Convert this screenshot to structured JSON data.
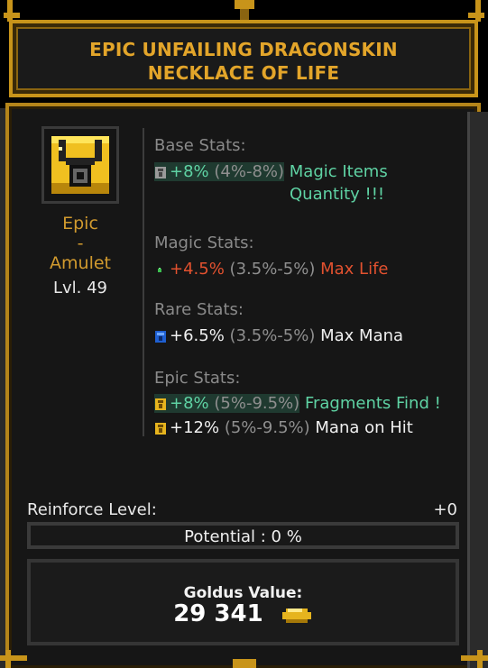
{
  "item": {
    "title_line1": "EPIC UNFAILING DRAGONSKIN",
    "title_line2": "NECKLACE OF LIFE",
    "rarity": "Epic",
    "dash": "-",
    "type": "Amulet",
    "level": "Lvl. 49",
    "icon": "golden-amulet-icon"
  },
  "sections": {
    "base": {
      "header": "Base Stats:",
      "stats": [
        {
          "value": "+8%",
          "range": "(4%-8%)",
          "name_line1": "Magic Items",
          "name_line2": "Quantity !!!",
          "gem": "gray-gem-icon",
          "value_color": "#5fd3a4",
          "name_color": "#5fd3a4"
        }
      ]
    },
    "magic": {
      "header": "Magic Stats:",
      "stats": [
        {
          "value": "+4.5%",
          "range": "(3.5%-5%)",
          "name": "Max Life",
          "gem": "green-gem-icon",
          "value_color": "#e2512f",
          "name_color": "#e2512f"
        }
      ]
    },
    "rare": {
      "header": "Rare Stats:",
      "stats": [
        {
          "value": "+6.5%",
          "range": "(3.5%-5%)",
          "name": "Max Mana",
          "gem": "blue-gem-icon",
          "value_color": "#f0f0f0",
          "name_color": "#f0f0f0"
        }
      ]
    },
    "epic": {
      "header": "Epic Stats:",
      "stats": [
        {
          "value": "+8%",
          "range": "(5%-9.5%)",
          "name": "Fragments Find !",
          "gem": "gold-gem-icon",
          "value_color": "#5fd3a4",
          "name_color": "#5fd3a4"
        },
        {
          "value": "+12%",
          "range": "(5%-9.5%)",
          "name": "Mana on Hit",
          "gem": "gold-gem-icon",
          "value_color": "#f0f0f0",
          "name_color": "#f0f0f0"
        }
      ]
    }
  },
  "reinforce": {
    "label": "Reinforce Level:",
    "value": "+0"
  },
  "potential": {
    "text": "Potential : 0 %"
  },
  "goldus": {
    "label": "Goldus Value:",
    "value": "29 341",
    "icon": "gold-nugget-icon"
  },
  "colors": {
    "frame_gold": "#c8941a",
    "title_gold": "#e3a52a",
    "highlight_green": "#5fd3a4",
    "life_red": "#e2512f"
  }
}
